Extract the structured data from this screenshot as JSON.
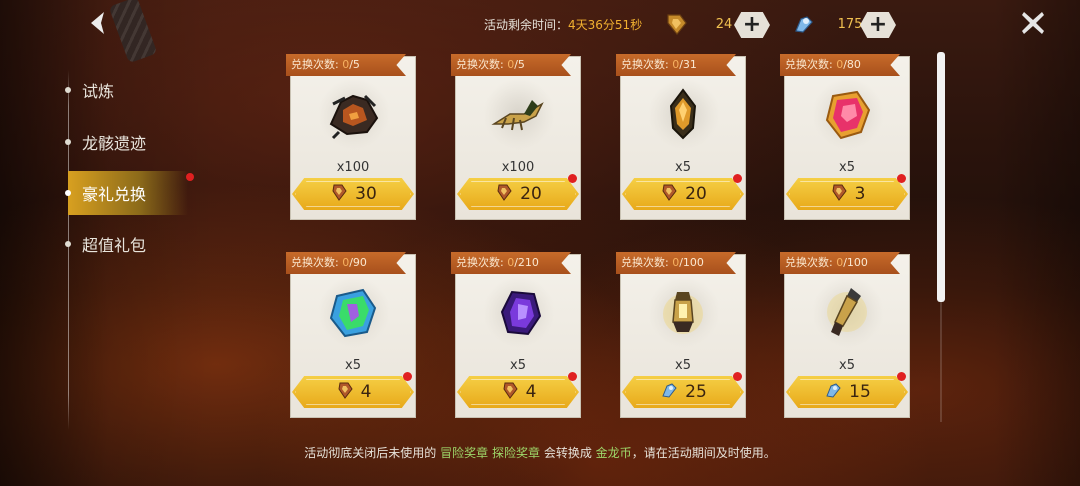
{
  "header": {
    "timer_label": "活动剩余时间：",
    "timer_value": "4天36分51秒",
    "currency_1": {
      "icon": "adventure-medal-icon",
      "amount": "24"
    },
    "currency_2": {
      "icon": "explore-medal-icon",
      "amount": "175"
    }
  },
  "sidebar": {
    "items": [
      {
        "label": "试炼",
        "active": false
      },
      {
        "label": "龙骸遗迹",
        "active": false
      },
      {
        "label": "豪礼兑换",
        "active": true,
        "badge": true
      },
      {
        "label": "超值礼包",
        "active": false
      }
    ]
  },
  "exchange_label": "兑换次数: ",
  "cards": [
    {
      "used": "0",
      "limit": "/5",
      "item": "dragon-armor-pile",
      "qty": "x100",
      "currency": "adventure-medal-icon",
      "price": "30",
      "badge": false
    },
    {
      "used": "0",
      "limit": "/5",
      "item": "dragon-skeleton",
      "qty": "x100",
      "currency": "adventure-medal-icon",
      "price": "20",
      "badge": true
    },
    {
      "used": "0",
      "limit": "/31",
      "item": "amber-crystal",
      "qty": "x5",
      "currency": "adventure-medal-icon",
      "price": "20",
      "badge": true
    },
    {
      "used": "0",
      "limit": "/80",
      "item": "ruby-crystal",
      "qty": "x5",
      "currency": "adventure-medal-icon",
      "price": "3",
      "badge": true
    },
    {
      "used": "0",
      "limit": "/90",
      "item": "emerald-crystal",
      "qty": "x5",
      "currency": "adventure-medal-icon",
      "price": "4",
      "badge": true
    },
    {
      "used": "0",
      "limit": "/210",
      "item": "amethyst-crystal",
      "qty": "x5",
      "currency": "adventure-medal-icon",
      "price": "4",
      "badge": true
    },
    {
      "used": "0",
      "limit": "/100",
      "item": "golden-lantern",
      "qty": "x5",
      "currency": "explore-medal-icon",
      "price": "25",
      "badge": true
    },
    {
      "used": "0",
      "limit": "/100",
      "item": "golden-key",
      "qty": "x5",
      "currency": "explore-medal-icon",
      "price": "15",
      "badge": true
    }
  ],
  "footer": {
    "prefix": "活动彻底关闭后未使用的",
    "medal_1": "冒险奖章",
    "medal_2": "探险奖章",
    "middle": "会转换成",
    "coin": "金龙币",
    "suffix": "，请在活动期间及时使用。"
  }
}
